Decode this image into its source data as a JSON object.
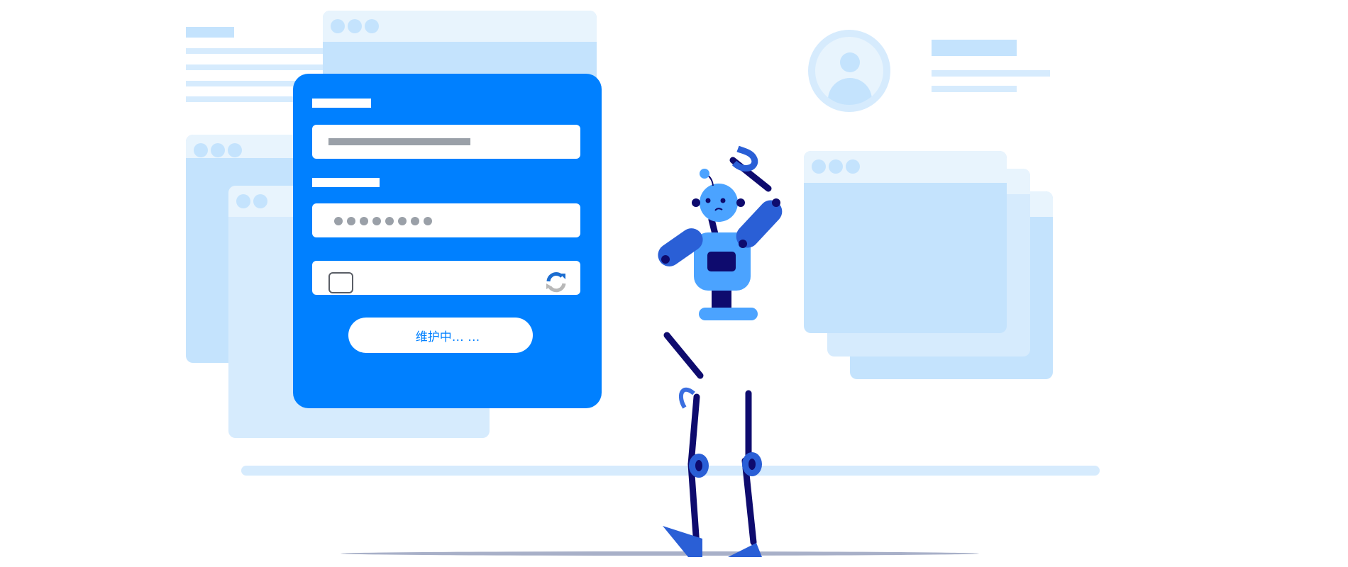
{
  "form": {
    "submit_button_label": "维护中… …"
  },
  "colors": {
    "primary": "#0080ff",
    "light_blue": "#c4e3fd",
    "lighter_blue": "#d6ebfd",
    "robot_dark": "#0e0b6e",
    "robot_blue": "#4ba3ff"
  },
  "icons": [
    "recaptcha-icon",
    "checkbox-icon",
    "avatar-icon",
    "robot-illustration"
  ]
}
